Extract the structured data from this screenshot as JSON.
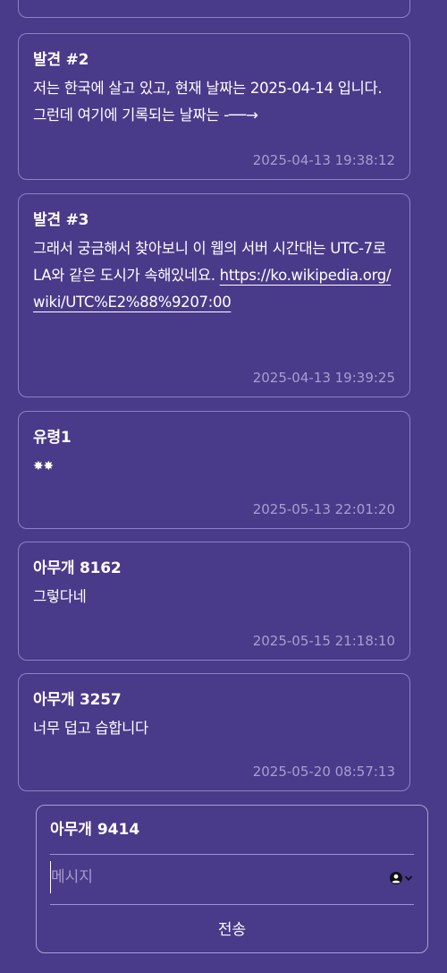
{
  "posts": [
    {
      "author": "발견 #2",
      "message": "저는 한국에 살고 있고, 현재 날짜는 2025-04-14 입니다. 그런데 여기에 기록되는 날짜는 -──→",
      "timestamp": "2025-04-13 19:38:12"
    },
    {
      "author": "발견 #3",
      "message": "그래서 궁금해서 찾아보니 이 웹의 서버 시간대는 UTC-7로 LA와 같은 도시가 속해있네요.",
      "link": "https://ko.wikipedia.org/wiki/UTC%E2%88%9207:00",
      "timestamp": "2025-04-13 19:39:25"
    },
    {
      "author": "유령1",
      "message": "✸✸",
      "timestamp": "2025-05-13 22:01:20"
    },
    {
      "author": "아무개 8162",
      "message": "그렇다네",
      "timestamp": "2025-05-15 21:18:10"
    },
    {
      "author": "아무개 3257",
      "message": "너무 덥고 습합니다",
      "timestamp": "2025-05-20 08:57:13"
    }
  ],
  "composer": {
    "username": "아무개 9414",
    "message_placeholder": "메시지",
    "send_label": "전송",
    "persona_icon": "user-circle-icon"
  }
}
